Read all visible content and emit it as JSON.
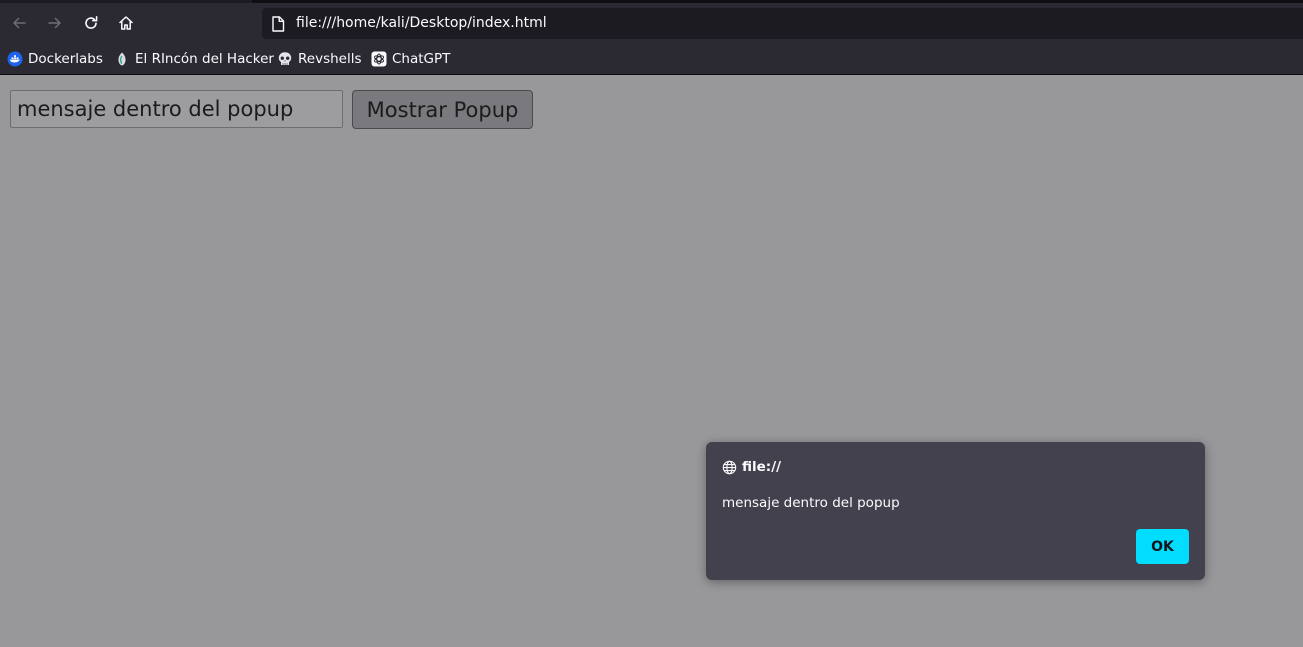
{
  "browser": {
    "url": "file:///home/kali/Desktop/index.html",
    "nav": {
      "back_icon": "arrow-left-icon",
      "forward_icon": "arrow-right-icon",
      "reload_icon": "reload-icon",
      "home_icon": "home-icon"
    },
    "bookmarks": [
      {
        "label": "Dockerlabs",
        "icon": "dockerlabs-icon"
      },
      {
        "label": "El RIncón del Hacker",
        "icon": "rincon-hacker-icon"
      },
      {
        "label": "Revshells",
        "icon": "skull-icon"
      },
      {
        "label": "ChatGPT",
        "icon": "chatgpt-icon"
      }
    ]
  },
  "page": {
    "input_value": "mensaje dentro del popup",
    "button_label": "Mostrar Popup"
  },
  "alert": {
    "origin": "file://",
    "message": "mensaje dentro del popup",
    "ok_label": "OK"
  },
  "colors": {
    "chrome_bg": "#2b2a33",
    "urlbar_bg": "#1c1b22",
    "page_bg": "#98989b",
    "dialog_bg": "#42414d",
    "accent": "#00ddff"
  }
}
